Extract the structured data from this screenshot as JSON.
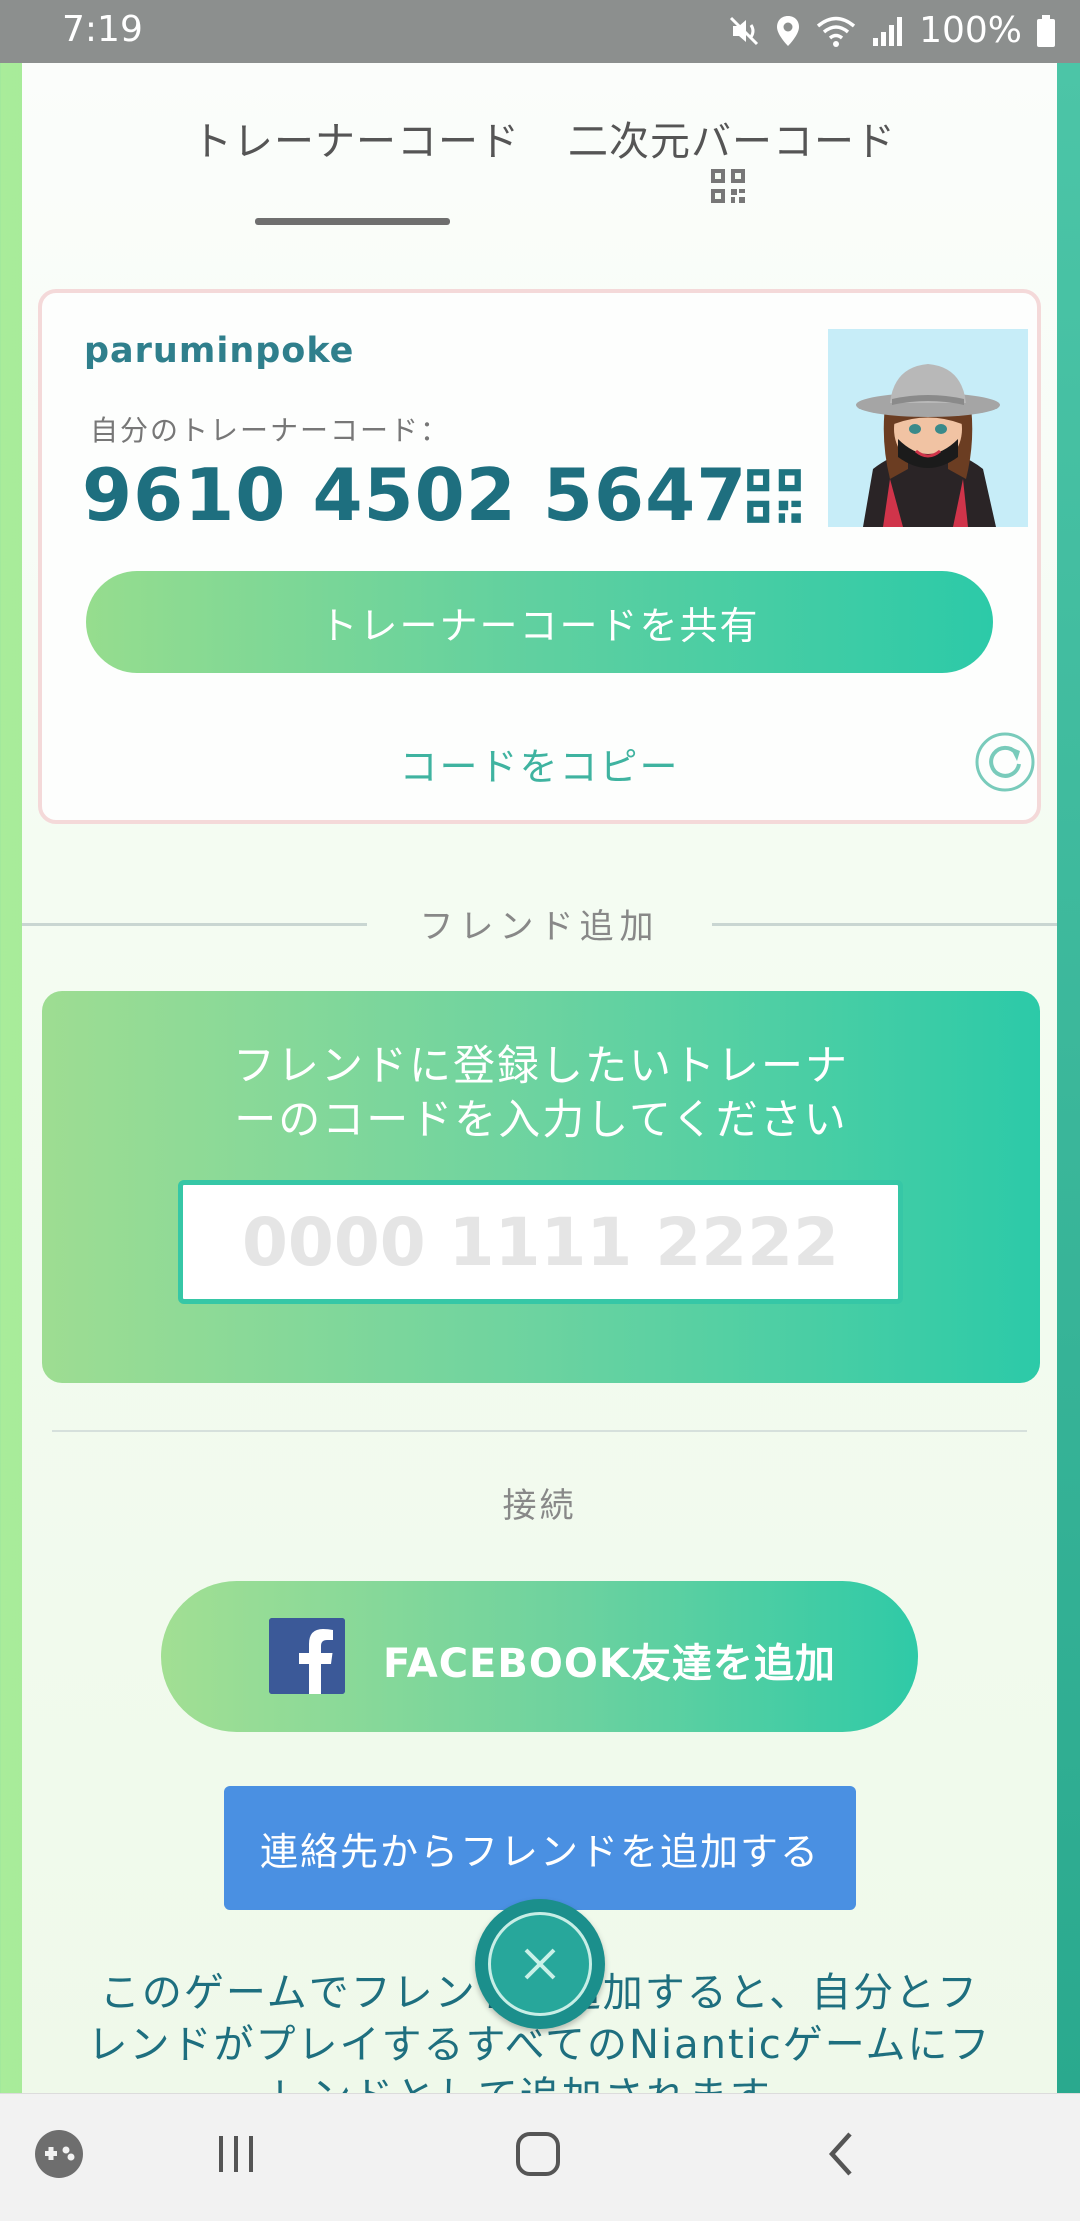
{
  "status_bar": {
    "time": "7:19",
    "battery_text": "100%",
    "icons": [
      "mute-vibrate-icon",
      "location-icon",
      "wifi-icon",
      "signal-icon",
      "battery-icon"
    ]
  },
  "tabs": {
    "trainer_code": "トレーナーコード",
    "qr_code": "二次元バーコード",
    "active": "trainer_code"
  },
  "trainer": {
    "username": "paruminpoke",
    "code_label": "自分のトレーナーコード：",
    "code": "9610 4502 5647",
    "share_button": "トレーナーコードを共有",
    "copy_link": "コードをコピー"
  },
  "friend_add": {
    "header": "フレンド追加",
    "instructions_line1": "フレンドに登録したいトレーナ",
    "instructions_line2": "ーのコードを入力してください",
    "input_placeholder": "0000 1111 2222",
    "input_value": ""
  },
  "connect": {
    "label": "接続",
    "facebook_button": "FACEBOOK友達を追加",
    "contacts_button": "連絡先からフレンドを追加する"
  },
  "info": {
    "line1": "このゲームでフレンドを追加すると、自分とフ",
    "line2": "レンドがプレイするすべてのNianticゲームにフ",
    "line3": "レンドとして追加されます。"
  },
  "colors": {
    "accent_green": "#2ccaa8",
    "code_teal": "#1e6f7f",
    "contacts_blue": "#4a90e2",
    "facebook_blue": "#3b5998"
  },
  "nav_bar": {
    "icons": [
      "game-launcher-icon",
      "recent-apps-icon",
      "home-icon",
      "back-icon"
    ]
  }
}
